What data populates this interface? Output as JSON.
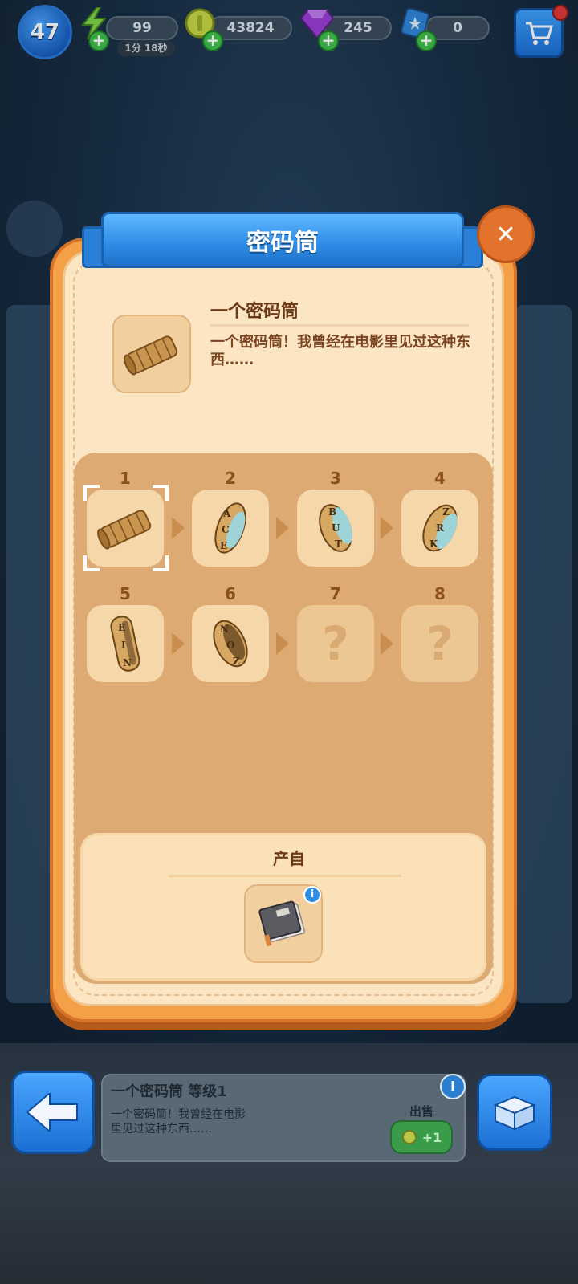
{
  "hud": {
    "level": "47",
    "energy": "99",
    "energy_timer": "1分 18秒",
    "coins": "43824",
    "gems": "245",
    "stars": "0"
  },
  "modal": {
    "title": "密码筒",
    "close_glyph": "✕",
    "item_name": "一个密码筒",
    "item_description": "一个密码筒！我曾经在电影里见过这种东西……",
    "chain": [
      {
        "num": "1",
        "icon": "cryptex-icon",
        "known": true,
        "selected": true
      },
      {
        "num": "2",
        "icon": "ring-ace-icon",
        "known": true,
        "letters": [
          "A",
          "C",
          "E"
        ]
      },
      {
        "num": "3",
        "icon": "ring-but-icon",
        "known": true,
        "letters": [
          "B",
          "U",
          "T"
        ]
      },
      {
        "num": "4",
        "icon": "ring-zrk-icon",
        "known": true,
        "letters": [
          "Z",
          "R",
          "K"
        ]
      },
      {
        "num": "5",
        "icon": "ring-ein-icon",
        "known": true,
        "letters": [
          "E",
          "I",
          "N"
        ]
      },
      {
        "num": "6",
        "icon": "ring-noz-icon",
        "known": true,
        "letters": [
          "N",
          "O",
          "Z"
        ]
      },
      {
        "num": "7",
        "icon": "question-icon",
        "known": false,
        "label": "?"
      },
      {
        "num": "8",
        "icon": "question-icon",
        "known": false,
        "label": "?"
      }
    ],
    "source_label": "产自",
    "source_icon": "notebook-icon",
    "source_info": "i"
  },
  "bottom": {
    "card_title": "一个密码筒 等级1",
    "card_desc": "一个密码筒！我曾经在电影里见过这种东西……",
    "info": "i",
    "sell_label": "出售",
    "sell_value": "+1"
  },
  "colors": {
    "modal_orange": "#f4a047",
    "ribbon_blue": "#2d8be6",
    "panel_tan": "#deaa73",
    "cream": "#fbe5c3"
  }
}
